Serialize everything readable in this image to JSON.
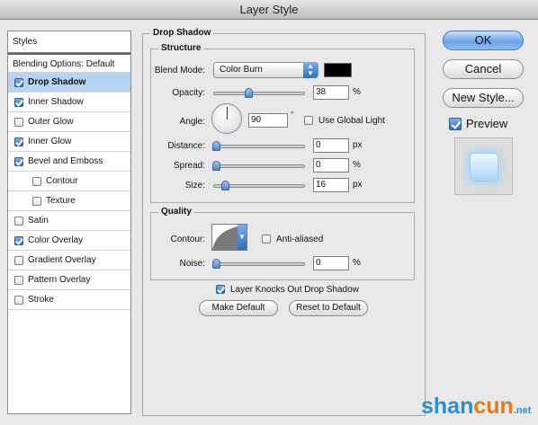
{
  "window": {
    "title": "Layer Style"
  },
  "sidebar": {
    "header": "Styles",
    "blending_options": "Blending Options: Default",
    "items": [
      {
        "label": "Drop Shadow",
        "checked": true,
        "selected": true,
        "sub": false
      },
      {
        "label": "Inner Shadow",
        "checked": true,
        "selected": false,
        "sub": false
      },
      {
        "label": "Outer Glow",
        "checked": false,
        "selected": false,
        "sub": false
      },
      {
        "label": "Inner Glow",
        "checked": true,
        "selected": false,
        "sub": false
      },
      {
        "label": "Bevel and Emboss",
        "checked": true,
        "selected": false,
        "sub": false
      },
      {
        "label": "Contour",
        "checked": false,
        "selected": false,
        "sub": true
      },
      {
        "label": "Texture",
        "checked": false,
        "selected": false,
        "sub": true
      },
      {
        "label": "Satin",
        "checked": false,
        "selected": false,
        "sub": false
      },
      {
        "label": "Color Overlay",
        "checked": true,
        "selected": false,
        "sub": false
      },
      {
        "label": "Gradient Overlay",
        "checked": false,
        "selected": false,
        "sub": false
      },
      {
        "label": "Pattern Overlay",
        "checked": false,
        "selected": false,
        "sub": false
      },
      {
        "label": "Stroke",
        "checked": false,
        "selected": false,
        "sub": false
      }
    ]
  },
  "panel": {
    "title": "Drop Shadow",
    "structure": {
      "title": "Structure",
      "blend_mode_label": "Blend Mode:",
      "blend_mode_value": "Color Burn",
      "shadow_color": "#000000",
      "opacity_label": "Opacity:",
      "opacity_value": "38",
      "opacity_unit": "%",
      "angle_label": "Angle:",
      "angle_value": "90",
      "angle_unit": "°",
      "use_global_light_label": "Use Global Light",
      "use_global_light_checked": false,
      "distance_label": "Distance:",
      "distance_value": "0",
      "distance_unit": "px",
      "spread_label": "Spread:",
      "spread_value": "0",
      "spread_unit": "%",
      "size_label": "Size:",
      "size_value": "16",
      "size_unit": "px"
    },
    "quality": {
      "title": "Quality",
      "contour_label": "Contour:",
      "anti_aliased_label": "Anti-aliased",
      "anti_aliased_checked": false,
      "noise_label": "Noise:",
      "noise_value": "0",
      "noise_unit": "%"
    },
    "knocks_out_label": "Layer Knocks Out Drop Shadow",
    "knocks_out_checked": true,
    "make_default_label": "Make Default",
    "reset_default_label": "Reset to Default"
  },
  "buttons": {
    "ok_label": "OK",
    "cancel_label": "Cancel",
    "new_style_label": "New Style...",
    "preview_label": "Preview",
    "preview_checked": true
  },
  "watermark": {
    "part1": "shan",
    "part2": "cun",
    "part3": ".net"
  },
  "colors": {
    "selection": "#b6d3f2",
    "accent": "#3c74c6",
    "watermark_blue": "#2a8fd0",
    "watermark_orange": "#e07a1f"
  }
}
